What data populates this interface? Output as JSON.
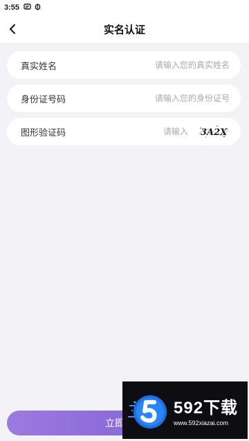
{
  "status_bar": {
    "time": "3:55"
  },
  "header": {
    "title": "实名认证",
    "back_icon": "chevron-left-icon"
  },
  "form": {
    "name_label": "真实姓名",
    "name_placeholder": "请输入您的真实姓名",
    "id_label": "身份证号码",
    "id_placeholder": "请输入您的身份证号",
    "captcha_label": "图形验证码",
    "captcha_placeholder": "请输入",
    "captcha_text": "3A2X"
  },
  "submit": {
    "label": "立即认证"
  },
  "watermark": {
    "brand": "592下载",
    "url": "www.592xiazai.com"
  },
  "colors": {
    "accent_start": "#9b7ae0",
    "accent_end": "#7a5ad2",
    "background": "#f3f2f7"
  }
}
